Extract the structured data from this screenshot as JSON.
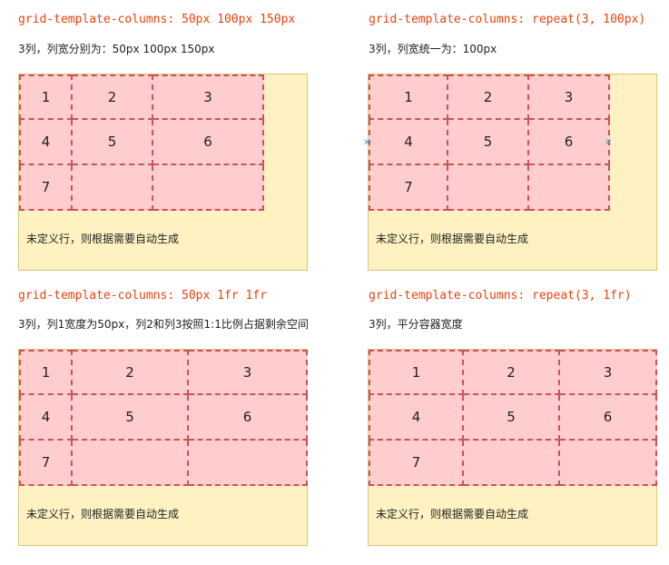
{
  "panels": [
    {
      "code": "grid-template-columns: 50px 100px 150px",
      "desc": "3列，列宽分别为：50px 100px 150px",
      "cells": [
        "1",
        "2",
        "3",
        "4",
        "5",
        "6",
        "7",
        "",
        ""
      ],
      "note": "未定义行，则根据需要自动生成"
    },
    {
      "code": "grid-template-columns: repeat(3, 100px)",
      "desc": "3列，列宽统一为：100px",
      "cells": [
        "1",
        "2",
        "3",
        "4",
        "5",
        "6",
        "7",
        "",
        ""
      ],
      "note": "未定义行，则根据需要自动生成"
    },
    {
      "code": "grid-template-columns: 50px 1fr 1fr",
      "desc": "3列，列1宽度为50px，列2和列3按照1:1比例占据剩余空间",
      "cells": [
        "1",
        "2",
        "3",
        "4",
        "5",
        "6",
        "7",
        "",
        ""
      ],
      "note": "未定义行，则根据需要自动生成"
    },
    {
      "code": "grid-template-columns: repeat(3, 1fr)",
      "desc": "3列，平分容器宽度",
      "cells": [
        "1",
        "2",
        "3",
        "4",
        "5",
        "6",
        "7",
        "",
        ""
      ],
      "note": "未定义行，则根据需要自动生成"
    }
  ],
  "colors": {
    "code": "#e8420d",
    "container_bg": "#fff2c2",
    "container_border": "#dcc377",
    "cell_bg": "#ffcdcd",
    "cell_border": "#c9535a"
  }
}
